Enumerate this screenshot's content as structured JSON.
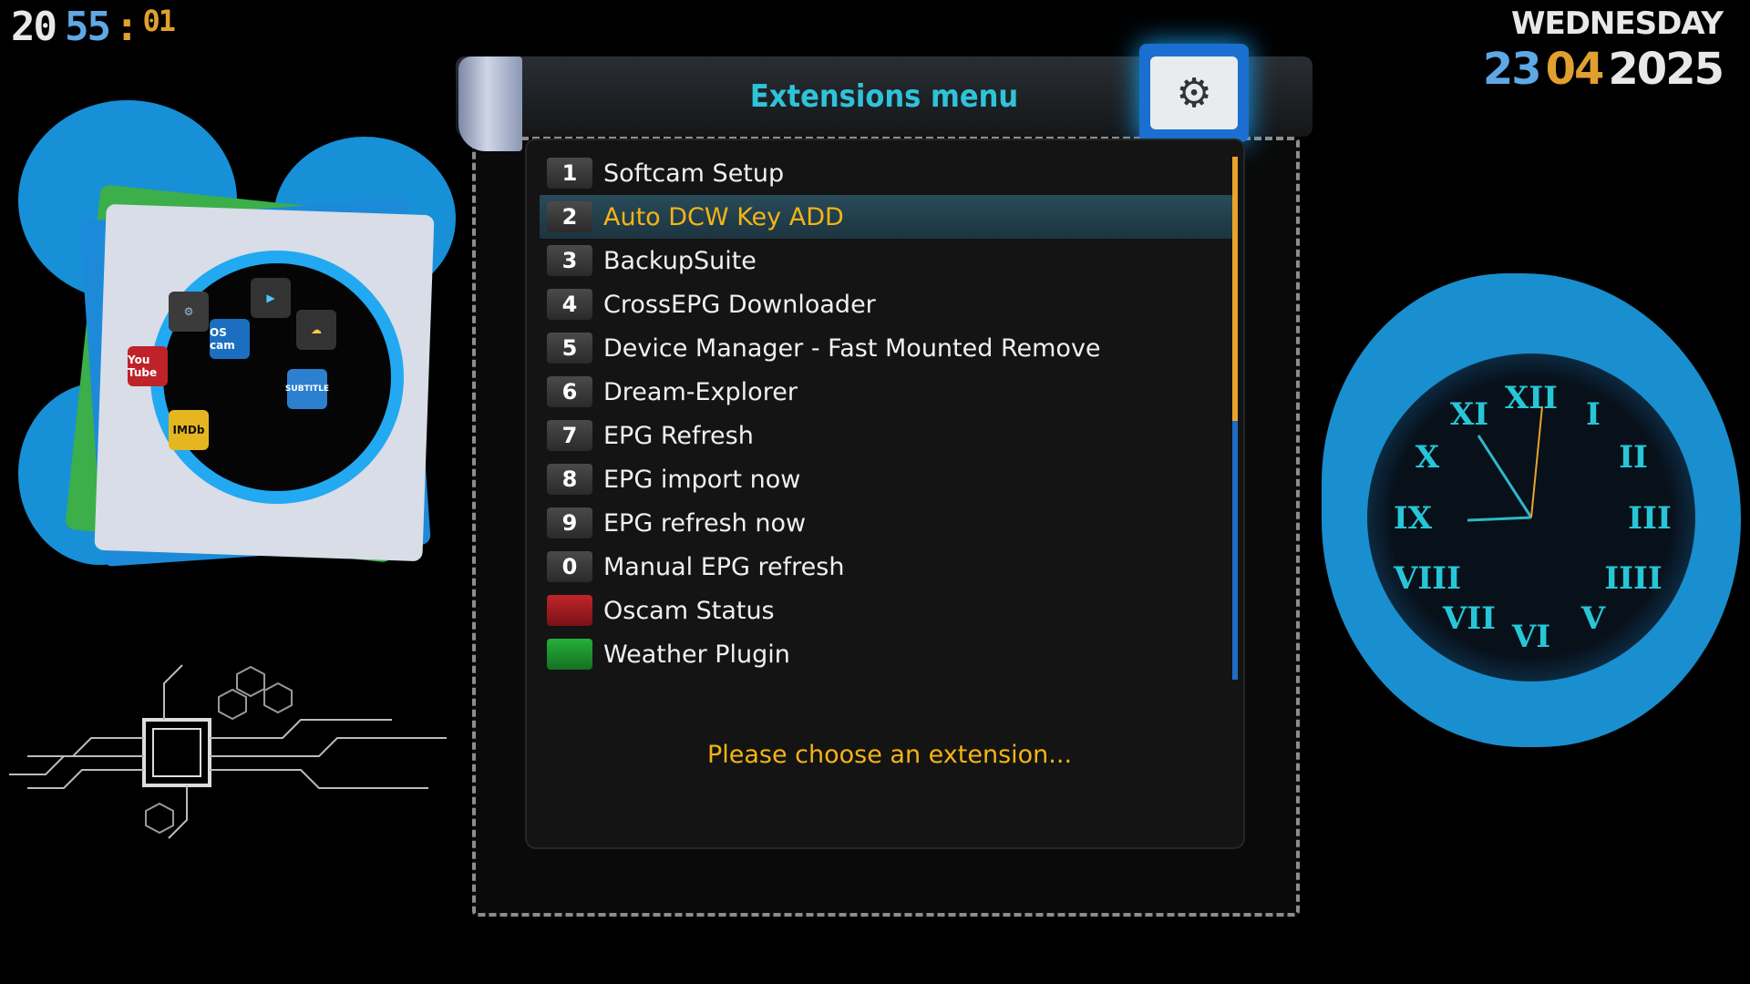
{
  "clock": {
    "hours": "20",
    "minutes": "55",
    "colon": ":",
    "seconds": "01"
  },
  "date": {
    "weekday": "WEDNESDAY",
    "day": "23",
    "month": "04",
    "year": "2025"
  },
  "header": {
    "title": "Extensions menu",
    "icon": "settings-gears-icon"
  },
  "menu": {
    "items": [
      {
        "key": "1",
        "label": "Softcam Setup",
        "selected": false
      },
      {
        "key": "2",
        "label": "Auto DCW Key ADD",
        "selected": true
      },
      {
        "key": "3",
        "label": "BackupSuite",
        "selected": false
      },
      {
        "key": "4",
        "label": "CrossEPG Downloader",
        "selected": false
      },
      {
        "key": "5",
        "label": "Device Manager - Fast Mounted Remove",
        "selected": false
      },
      {
        "key": "6",
        "label": "Dream-Explorer",
        "selected": false
      },
      {
        "key": "7",
        "label": "EPG Refresh",
        "selected": false
      },
      {
        "key": "8",
        "label": "EPG import now",
        "selected": false
      },
      {
        "key": "9",
        "label": "EPG refresh now",
        "selected": false
      },
      {
        "key": "0",
        "label": "Manual EPG refresh",
        "selected": false
      },
      {
        "key": "",
        "label": "Oscam Status",
        "color": "#c0242a",
        "selected": false
      },
      {
        "key": "",
        "label": "Weather Plugin",
        "color": "#25b03a",
        "selected": false
      }
    ],
    "status": "Please choose an extension..."
  },
  "analog_clock": {
    "numerals": [
      "XII",
      "I",
      "II",
      "III",
      "IIII",
      "V",
      "VI",
      "VII",
      "VIII",
      "IX",
      "X",
      "XI"
    ],
    "time_shown": "20:55"
  },
  "decor": {
    "tiles": [
      "You Tube",
      "OS cam",
      "IMDb",
      "SUBTITLE"
    ],
    "accent": "#1aa0f0"
  },
  "colors": {
    "title": "#2fc3d9",
    "selected": "#f5b416",
    "status": "#f5b416"
  }
}
